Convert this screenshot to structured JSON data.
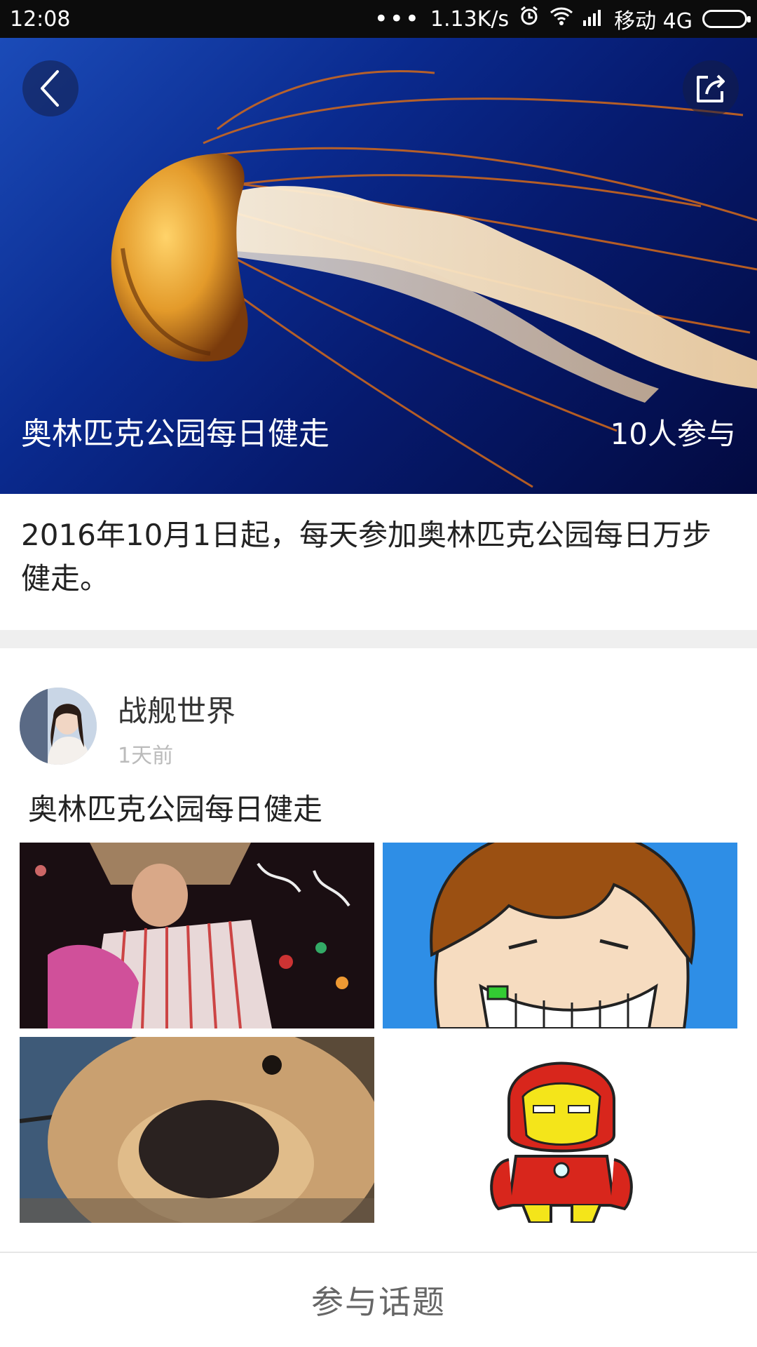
{
  "status_bar": {
    "time": "12:08",
    "dots": "•••",
    "net_speed": "1.13K/s",
    "carrier": "移动 4G",
    "icons": [
      "alarm-icon",
      "wifi-icon",
      "signal-icon",
      "battery-icon"
    ]
  },
  "hero": {
    "title": "奥林匹克公园每日健走",
    "participants": "10人参与",
    "icons": [
      "back-arrow-icon",
      "share-icon"
    ]
  },
  "description": "2016年10月1日起，每天参加奥林匹克公园每日万步健走。",
  "post": {
    "author": "战舰世界",
    "time_ago": "1天前",
    "title": "奥林匹克公园每日健走"
  },
  "bottom_bar": {
    "join_label": "参与话题"
  },
  "colors": {
    "hero_blue": "#0a2a8e",
    "photo_blue": "#2e8ee6",
    "band_gray": "#efefef"
  }
}
